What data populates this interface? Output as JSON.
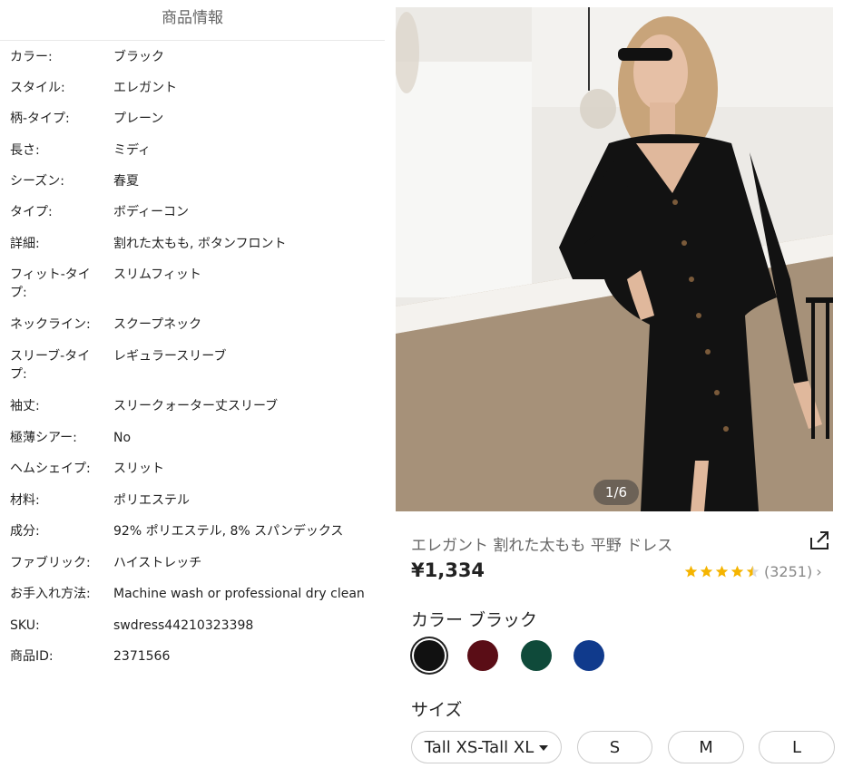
{
  "left_panel": {
    "title": "商品情報",
    "attributes": [
      {
        "label": "カラー:",
        "value": "ブラック"
      },
      {
        "label": "スタイル:",
        "value": "エレガント"
      },
      {
        "label": "柄-タイプ:",
        "value": "プレーン"
      },
      {
        "label": "長さ:",
        "value": "ミディ"
      },
      {
        "label": "シーズン:",
        "value": "春夏"
      },
      {
        "label": "タイプ:",
        "value": "ボディーコン"
      },
      {
        "label": "詳細:",
        "value": "割れた太もも, ボタンフロント"
      },
      {
        "label": "フィット-タイプ:",
        "value": "スリムフィット"
      },
      {
        "label": "ネックライン:",
        "value": "スクープネック"
      },
      {
        "label": "スリーブ-タイプ:",
        "value": "レギュラースリーブ"
      },
      {
        "label": "袖丈:",
        "value": "スリークォーター丈スリーブ"
      },
      {
        "label": "極薄シアー:",
        "value": "No"
      },
      {
        "label": "ヘムシェイプ:",
        "value": "スリット"
      },
      {
        "label": "材料:",
        "value": "ポリエステル"
      },
      {
        "label": "成分:",
        "value": "92% ポリエステル, 8% スパンデックス"
      },
      {
        "label": "ファブリック:",
        "value": "ハイストレッチ"
      },
      {
        "label": "お手入れ方法:",
        "value": "Machine wash or professional dry clean"
      },
      {
        "label": "SKU:",
        "value": "swdress44210323398"
      },
      {
        "label": "商品ID:",
        "value": "2371566"
      }
    ]
  },
  "product": {
    "image_counter": "1/6",
    "title": "エレガント 割れた太もも 平野 ドレス",
    "price": "¥1,334",
    "rating": {
      "stars": 4.5,
      "count": "(3251)",
      "chevron": "›"
    },
    "color_label": "カラー ブラック",
    "colors": [
      {
        "name": "black",
        "hex": "#111111",
        "selected": true
      },
      {
        "name": "burgundy",
        "hex": "#5a0d16",
        "selected": false
      },
      {
        "name": "dark-green",
        "hex": "#0f4a3a",
        "selected": false
      },
      {
        "name": "navy-blue",
        "hex": "#103a8c",
        "selected": false
      }
    ],
    "size_label": "サイズ",
    "sizes": [
      {
        "label": "Tall XS-Tall XL",
        "dropdown": true
      },
      {
        "label": "S"
      },
      {
        "label": "M"
      },
      {
        "label": "L"
      }
    ]
  },
  "icons": {
    "share": "share-icon",
    "star": "star-icon",
    "dropdown": "caret-down-icon"
  },
  "colors": {
    "star": "#f5b400",
    "text_secondary": "#666666",
    "border": "#cccccc"
  }
}
